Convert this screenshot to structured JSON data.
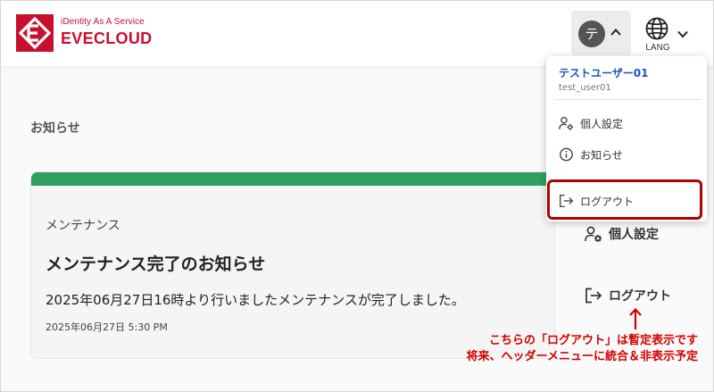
{
  "header": {
    "brand_tag": "iDentity As A Service",
    "brand_name": "EVECLOUD",
    "avatar_letter": "テ",
    "lang_label": "LANG"
  },
  "page": {
    "title": "お知らせ"
  },
  "notice": {
    "category": "メンテナンス",
    "title": "メンテナンス完了のお知らせ",
    "body": "2025年06月27日16時より行いましたメンテナンスが完了しました。",
    "date": "2025年06月27日 5:30 PM"
  },
  "side_menu": {
    "profile_label": "個人設定",
    "logout_label": "ログアウト"
  },
  "dropdown": {
    "user_name": "テストユーザー01",
    "user_id": "test_user01",
    "items": [
      {
        "label": "個人設定",
        "icon": "user-gear-icon"
      },
      {
        "label": "お知らせ",
        "icon": "info-icon"
      },
      {
        "label": "ログアウト",
        "icon": "logout-icon"
      }
    ]
  },
  "annotation": {
    "line1": "こちらの「ログアウト」は暫定表示です",
    "line2": "将来、ヘッダーメニューに統合＆非表示予定"
  },
  "colors": {
    "brand": "#c8102e",
    "card_bar": "#2e9e62",
    "link_blue": "#1a56b4",
    "highlight": "#b00000",
    "annotation": "#d40000"
  }
}
